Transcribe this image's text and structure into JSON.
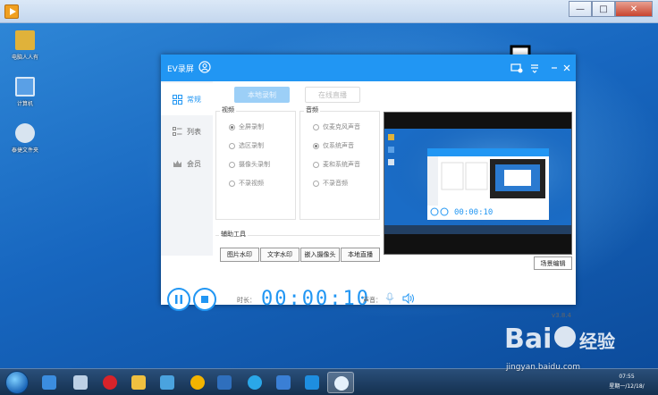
{
  "outer_window": {
    "controls": {
      "minimize": "—",
      "maximize": "□",
      "close": "✕"
    }
  },
  "desktop_icons": [
    {
      "label": "电脑人人有",
      "icon": "folder-user-icon",
      "color": "#e0b23a"
    },
    {
      "label": "计算机",
      "icon": "computer-icon",
      "color": "#5aa0e6"
    },
    {
      "label": "泰捷文件夹",
      "icon": "tiger-folder-icon",
      "color": "#d8e4f0"
    }
  ],
  "ev_app": {
    "title": "EV录屏",
    "sidebar": [
      {
        "label": "常规",
        "icon": "grid-icon",
        "active": true
      },
      {
        "label": "列表",
        "icon": "list-icon",
        "active": false
      },
      {
        "label": "会员",
        "icon": "crown-icon",
        "active": false
      }
    ],
    "modes": {
      "local": "本地录制",
      "live": "在线直播"
    },
    "video_group": {
      "title": "视频",
      "options": [
        {
          "label": "全屏录制",
          "selected": true
        },
        {
          "label": "选区录制",
          "selected": false
        },
        {
          "label": "摄像头录制",
          "selected": false
        },
        {
          "label": "不录视频",
          "selected": false
        }
      ]
    },
    "audio_group": {
      "title": "音频",
      "options": [
        {
          "label": "仅麦克风声音",
          "selected": false
        },
        {
          "label": "仅系统声音",
          "selected": true
        },
        {
          "label": "麦和系统声音",
          "selected": false
        },
        {
          "label": "不录音频",
          "selected": false
        }
      ]
    },
    "tools": {
      "title": "辅助工具",
      "buttons": [
        "图片水印",
        "文字水印",
        "嵌入摄像头",
        "本地直播"
      ]
    },
    "scene_button": "场景编辑",
    "time_label": "时长：",
    "timer": "00:00:10",
    "sound_label": "声音：",
    "version": "v3.8.4"
  },
  "taskbar": {
    "apps": [
      {
        "icon": "desktop-icon",
        "color": "#3b8de0",
        "active": false
      },
      {
        "icon": "qq-icon",
        "color": "#bcd0e6",
        "active": false
      },
      {
        "icon": "jiang-icon",
        "color": "#d8232a",
        "active": false
      },
      {
        "icon": "folder-icon",
        "color": "#f0c040",
        "active": false
      },
      {
        "icon": "wps-icon",
        "color": "#4aa3df",
        "active": false
      },
      {
        "icon": "chrome-icon",
        "color": "#f2b400",
        "active": false
      },
      {
        "icon": "word-icon",
        "color": "#2f6fbd",
        "active": false
      },
      {
        "icon": "cloud-icon",
        "color": "#2aa7e8",
        "active": false
      },
      {
        "icon": "sogou-icon",
        "color": "#3a7fd5",
        "active": false
      },
      {
        "icon": "ie-icon",
        "color": "#1e8ee0",
        "active": false
      },
      {
        "icon": "ev-icon",
        "color": "#e6f1fb",
        "active": true
      }
    ],
    "clock_time": "07:55",
    "clock_date": "星期一/12/18/"
  },
  "watermark": {
    "text": "jingyan.baidu.com"
  }
}
